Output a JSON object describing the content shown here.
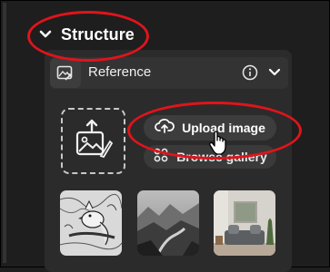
{
  "section": {
    "title": "Structure",
    "chevron_icon": "chevron-down-icon"
  },
  "reference": {
    "label": "Reference",
    "icon": "reference-image-icon",
    "info_icon": "info-icon",
    "collapse_icon": "chevron-down-icon"
  },
  "upload_area": {
    "icon": "image-upload-icon"
  },
  "buttons": {
    "upload_label": "Upload image",
    "upload_icon": "cloud-upload-icon",
    "browse_label": "Browse gallery",
    "browse_icon": "gallery-icon"
  },
  "thumbnails": [
    {
      "name": "bird-sketch-thumbnail"
    },
    {
      "name": "misty-valley-thumbnail"
    },
    {
      "name": "living-room-thumbnail"
    }
  ],
  "colors": {
    "highlight": "#e0141b",
    "panel": "#2b2b2b",
    "button": "#3d3d3d",
    "background": "#1e1e1e"
  }
}
